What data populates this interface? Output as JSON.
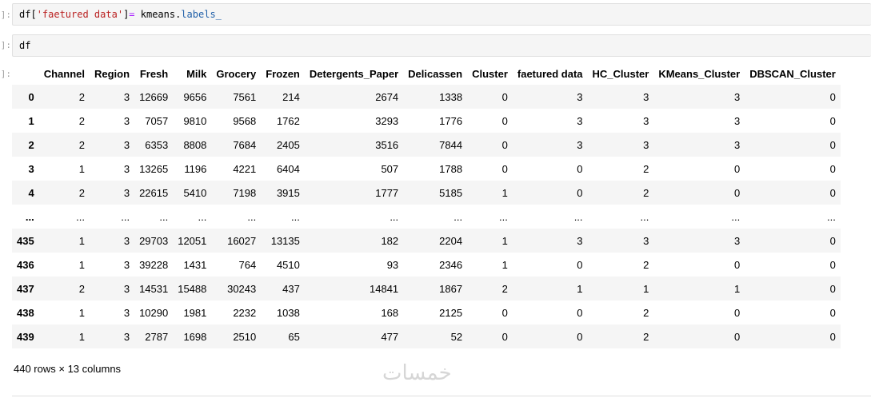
{
  "cells": [
    {
      "prompt": "]:",
      "tokens": [
        {
          "t": "df[",
          "c": "tok-var"
        },
        {
          "t": "'faetured data'",
          "c": "tok-str"
        },
        {
          "t": "]",
          "c": "tok-var"
        },
        {
          "t": "=",
          "c": "tok-op"
        },
        {
          "t": " kmeans.",
          "c": "tok-var"
        },
        {
          "t": "labels_",
          "c": "tok-attr"
        }
      ]
    },
    {
      "prompt": "]:",
      "tokens": [
        {
          "t": "df",
          "c": "tok-var"
        }
      ]
    }
  ],
  "output_prompt": "]:",
  "dataframe": {
    "columns": [
      "Channel",
      "Region",
      "Fresh",
      "Milk",
      "Grocery",
      "Frozen",
      "Detergents_Paper",
      "Delicassen",
      "Cluster",
      "faetured data",
      "HC_Cluster",
      "KMeans_Cluster",
      "DBSCAN_Cluster"
    ],
    "rows": [
      {
        "index": "0",
        "values": [
          "2",
          "3",
          "12669",
          "9656",
          "7561",
          "214",
          "2674",
          "1338",
          "0",
          "3",
          "3",
          "3",
          "0"
        ]
      },
      {
        "index": "1",
        "values": [
          "2",
          "3",
          "7057",
          "9810",
          "9568",
          "1762",
          "3293",
          "1776",
          "0",
          "3",
          "3",
          "3",
          "0"
        ]
      },
      {
        "index": "2",
        "values": [
          "2",
          "3",
          "6353",
          "8808",
          "7684",
          "2405",
          "3516",
          "7844",
          "0",
          "3",
          "3",
          "3",
          "0"
        ]
      },
      {
        "index": "3",
        "values": [
          "1",
          "3",
          "13265",
          "1196",
          "4221",
          "6404",
          "507",
          "1788",
          "0",
          "0",
          "2",
          "0",
          "0"
        ]
      },
      {
        "index": "4",
        "values": [
          "2",
          "3",
          "22615",
          "5410",
          "7198",
          "3915",
          "1777",
          "5185",
          "1",
          "0",
          "2",
          "0",
          "0"
        ]
      },
      {
        "index": "...",
        "values": [
          "...",
          "...",
          "...",
          "...",
          "...",
          "...",
          "...",
          "...",
          "...",
          "...",
          "...",
          "...",
          "..."
        ]
      },
      {
        "index": "435",
        "values": [
          "1",
          "3",
          "29703",
          "12051",
          "16027",
          "13135",
          "182",
          "2204",
          "1",
          "3",
          "3",
          "3",
          "0"
        ]
      },
      {
        "index": "436",
        "values": [
          "1",
          "3",
          "39228",
          "1431",
          "764",
          "4510",
          "93",
          "2346",
          "1",
          "0",
          "2",
          "0",
          "0"
        ]
      },
      {
        "index": "437",
        "values": [
          "2",
          "3",
          "14531",
          "15488",
          "30243",
          "437",
          "14841",
          "1867",
          "2",
          "1",
          "1",
          "1",
          "0"
        ]
      },
      {
        "index": "438",
        "values": [
          "1",
          "3",
          "10290",
          "1981",
          "2232",
          "1038",
          "168",
          "2125",
          "0",
          "0",
          "2",
          "0",
          "0"
        ]
      },
      {
        "index": "439",
        "values": [
          "1",
          "3",
          "2787",
          "1698",
          "2510",
          "65",
          "477",
          "52",
          "0",
          "0",
          "2",
          "0",
          "0"
        ]
      }
    ],
    "shape_text": "440 rows × 13 columns"
  },
  "watermark": "خمسات"
}
